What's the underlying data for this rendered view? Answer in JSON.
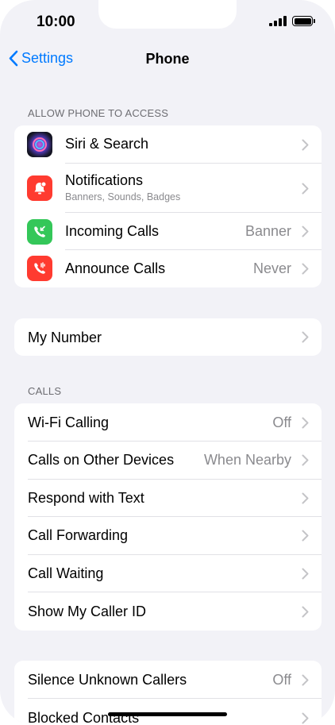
{
  "status_bar": {
    "time": "10:00"
  },
  "nav": {
    "back_label": "Settings",
    "title": "Phone"
  },
  "sections": {
    "allow_access": {
      "header": "ALLOW PHONE TO ACCESS",
      "items": [
        {
          "label": "Siri & Search",
          "icon": "siri-icon"
        },
        {
          "label": "Notifications",
          "sublabel": "Banners, Sounds, Badges",
          "icon": "notifications-icon",
          "icon_color": "#ff3b30"
        },
        {
          "label": "Incoming Calls",
          "value": "Banner",
          "icon": "incoming-calls-icon",
          "icon_color": "#34c759"
        },
        {
          "label": "Announce Calls",
          "value": "Never",
          "icon": "announce-calls-icon",
          "icon_color": "#ff3b30"
        }
      ]
    },
    "my_number": {
      "items": [
        {
          "label": "My Number"
        }
      ]
    },
    "calls": {
      "header": "CALLS",
      "items": [
        {
          "label": "Wi-Fi Calling",
          "value": "Off"
        },
        {
          "label": "Calls on Other Devices",
          "value": "When Nearby"
        },
        {
          "label": "Respond with Text"
        },
        {
          "label": "Call Forwarding"
        },
        {
          "label": "Call Waiting"
        },
        {
          "label": "Show My Caller ID"
        }
      ]
    },
    "silence": {
      "items": [
        {
          "label": "Silence Unknown Callers",
          "value": "Off"
        },
        {
          "label": "Blocked Contacts"
        }
      ]
    }
  },
  "colors": {
    "accent": "#007aff",
    "background": "#f2f2f7"
  }
}
